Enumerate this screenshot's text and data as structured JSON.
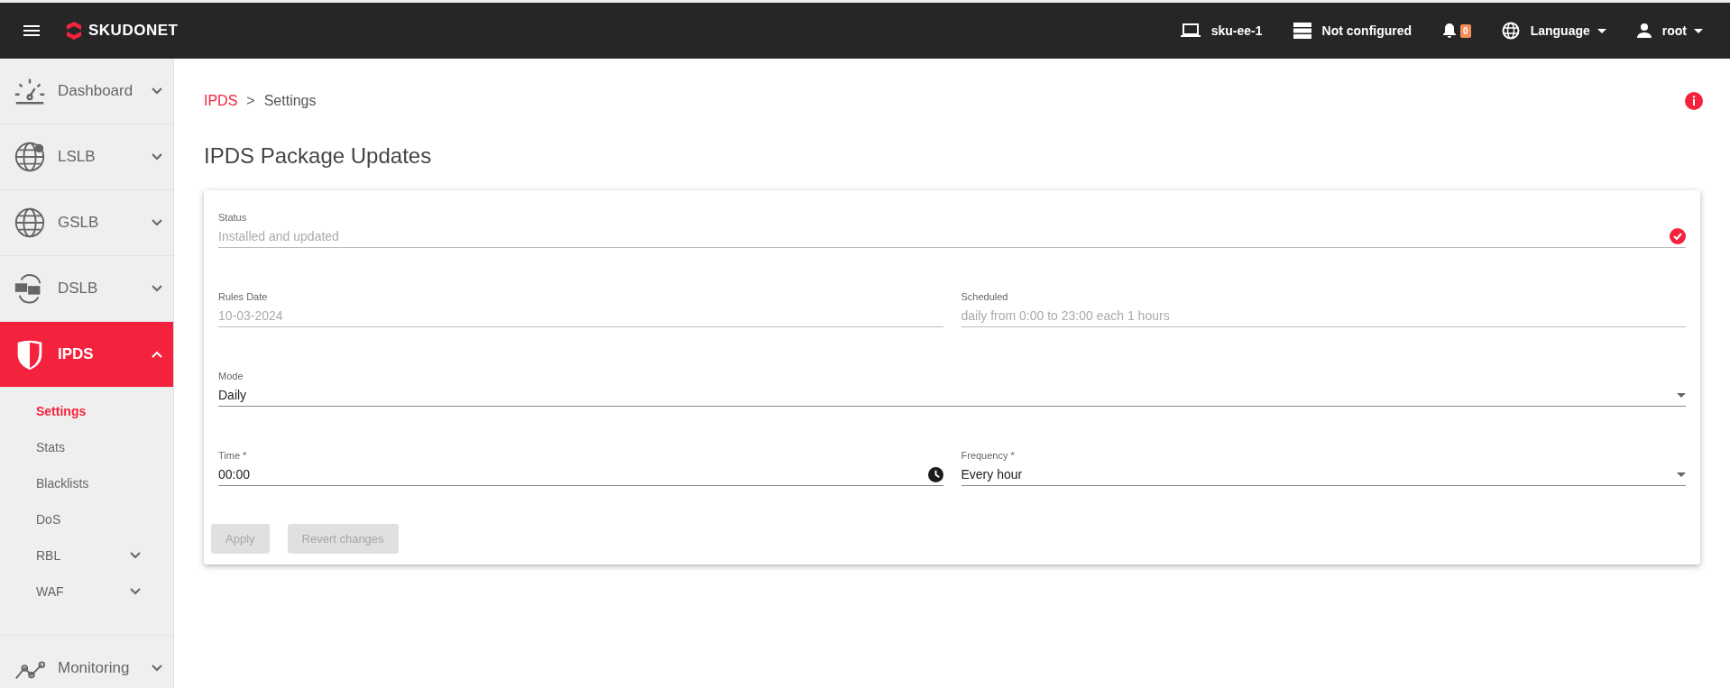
{
  "topbar": {
    "brand": "SKUDONET",
    "host": "sku-ee-1",
    "cluster": "Not configured",
    "notifications": "0",
    "language": "Language",
    "user": "root"
  },
  "sidebar": {
    "items": [
      {
        "label": "Dashboard",
        "selected": false,
        "expanded": false
      },
      {
        "label": "LSLB",
        "selected": false,
        "expanded": false
      },
      {
        "label": "GSLB",
        "selected": false,
        "expanded": false
      },
      {
        "label": "DSLB",
        "selected": false,
        "expanded": false
      },
      {
        "label": "IPDS",
        "selected": true,
        "expanded": true,
        "children": [
          {
            "label": "Settings",
            "selected": true,
            "expandable": false
          },
          {
            "label": "Stats",
            "selected": false,
            "expandable": false
          },
          {
            "label": "Blacklists",
            "selected": false,
            "expandable": false
          },
          {
            "label": "DoS",
            "selected": false,
            "expandable": false
          },
          {
            "label": "RBL",
            "selected": false,
            "expandable": true
          },
          {
            "label": "WAF",
            "selected": false,
            "expandable": true
          }
        ]
      },
      {
        "label": "Monitoring",
        "selected": false,
        "expanded": false
      }
    ]
  },
  "breadcrumb": {
    "items": [
      "IPDS",
      "Settings"
    ],
    "separator": ">"
  },
  "title": "IPDS Package Updates",
  "form": {
    "rows": [
      [
        {
          "kind": "text",
          "label": "Status",
          "value": "Installed and updated",
          "disabled": true,
          "ok": true
        }
      ],
      [
        {
          "kind": "text",
          "label": "Rules Date",
          "value": "10-03-2024",
          "disabled": true,
          "ok": false
        },
        {
          "kind": "text",
          "label": "Scheduled",
          "value": "daily from 0:00 to 23:00 each 1 hours",
          "disabled": true,
          "ok": false
        }
      ],
      [
        {
          "kind": "select",
          "label": "Mode",
          "value": "Daily",
          "disabled": false,
          "ok": false
        }
      ],
      [
        {
          "kind": "time",
          "label": "Time *",
          "value": "00:00",
          "disabled": false,
          "ok": false
        },
        {
          "kind": "select",
          "label": "Frequency *",
          "value": "Every hour",
          "disabled": false,
          "ok": false
        }
      ]
    ],
    "buttons": [
      {
        "label": "Apply",
        "disabled": true
      },
      {
        "label": "Revert changes",
        "disabled": true
      }
    ]
  }
}
